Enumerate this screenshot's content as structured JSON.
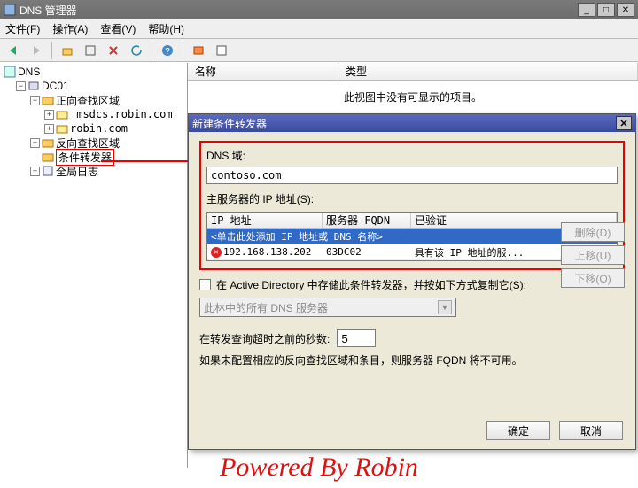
{
  "window": {
    "title": "DNS 管理器"
  },
  "menu": {
    "file": "文件(F)",
    "action": "操作(A)",
    "view": "查看(V)",
    "help": "帮助(H)"
  },
  "tree": {
    "root": "DNS",
    "server": "DC01",
    "fwd_zone": "正向查找区域",
    "fwd_children": [
      "_msdcs.robin.com",
      "robin.com"
    ],
    "rev_zone": "反向查找区域",
    "cond_fwd": "条件转发器",
    "global_log": "全局日志"
  },
  "list": {
    "col_name": "名称",
    "col_type": "类型",
    "empty_msg": "此视图中没有可显示的项目。"
  },
  "dialog": {
    "title": "新建条件转发器",
    "dns_domain_label": "DNS 域:",
    "dns_domain_value": "contoso.com",
    "servers_label": "主服务器的 IP 地址(S):",
    "grid": {
      "cols": [
        "IP 地址",
        "服务器 FQDN",
        "已验证"
      ],
      "hint_row": "<单击此处添加 IP 地址或 DNS 名称>",
      "row": {
        "ip": "192.168.138.202",
        "fqdn": "03DC02",
        "validated": "具有该 IP 地址的服..."
      }
    },
    "btn_delete": "删除(D)",
    "btn_up": "上移(U)",
    "btn_down": "下移(O)",
    "store_in_ad_label": "在 Active Directory 中存储此条件转发器，并按如下方式复制它(S):",
    "combo_value": "此林中的所有 DNS 服务器",
    "seconds_label": "在转发查询超时之前的秒数:",
    "seconds_value": "5",
    "note": "如果未配置相应的反向查找区域和条目，则服务器 FQDN 将不可用。",
    "ok": "确定",
    "cancel": "取消"
  },
  "watermark": "Powered By Robin"
}
